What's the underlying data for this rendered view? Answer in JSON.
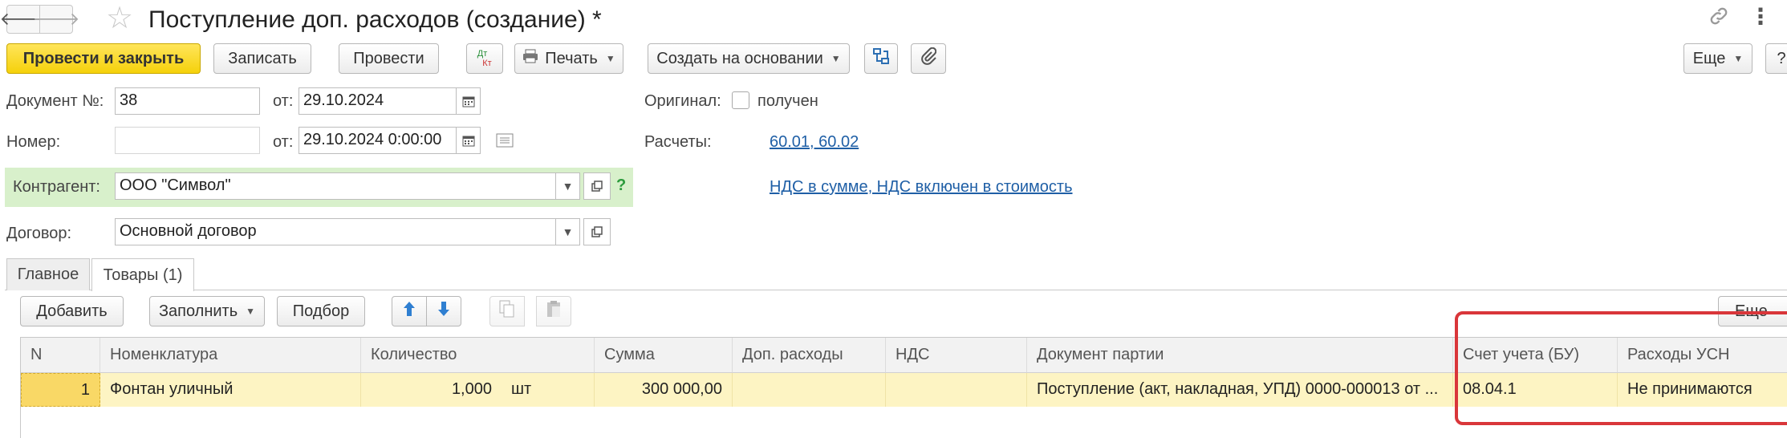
{
  "window": {
    "back_icon": "arrow-left-icon",
    "forward_icon": "arrow-right-icon",
    "favorite_icon": "star-icon",
    "title": "Поступление доп. расходов (создание) *",
    "link_icon": "chain-link-icon",
    "menu_icon": "vertical-dots-icon"
  },
  "toolbar": {
    "post_and_close": "Провести и закрыть",
    "save": "Записать",
    "post": "Провести",
    "dt_kt_top": "Дт",
    "dt_kt_bottom": "Кт",
    "print": "Печать",
    "create_based_on": "Создать на основании",
    "more": "Еще",
    "help": "?"
  },
  "header": {
    "doc_number_label": "Документ №:",
    "doc_number_value": "38",
    "date_label": "от:",
    "date_value": "29.10.2024",
    "number_label": "Номер:",
    "number_value": "",
    "date2_label": "от:",
    "date2_value": "29.10.2024  0:00:00",
    "original_label": "Оригинал:",
    "original_checkbox_label": "получен",
    "original_checked": false,
    "settlements_label": "Расчеты:",
    "settlements_link": "60.01, 60.02",
    "vat_link": "НДС в сумме, НДС включен в стоимость",
    "counterparty_label": "Контрагент:",
    "counterparty_value": "ООО \"Символ\"",
    "counterparty_help": "?",
    "contract_label": "Договор:",
    "contract_value": "Основной договор"
  },
  "tabs": [
    {
      "label": "Главное",
      "active": false
    },
    {
      "label": "Товары (1)",
      "active": true
    }
  ],
  "table_toolbar": {
    "add": "Добавить",
    "fill": "Заполнить",
    "select": "Подбор",
    "more": "Еще"
  },
  "table": {
    "columns": [
      "N",
      "Номенклатура",
      "Количество",
      "Сумма",
      "Доп. расходы",
      "НДС",
      "Документ партии",
      "Счет учета (БУ)",
      "Расходы УСН"
    ],
    "rows": [
      {
        "n": "1",
        "item": "Фонтан уличный",
        "qty": "1,000",
        "unit": "шт",
        "sum": "300 000,00",
        "extra": "",
        "vat": "",
        "batch_doc": "Поступление (акт, накладная, УПД) 0000-000013 от ...",
        "account": "08.04.1",
        "usn_expenses": "Не принимаются"
      }
    ]
  },
  "colors": {
    "primary_button": "#f5d10b",
    "highlight_box": "#d9363a",
    "selected_row": "#fdf4c3",
    "counterparty_bg": "#d8f0cb",
    "link": "#1f5fa6"
  }
}
